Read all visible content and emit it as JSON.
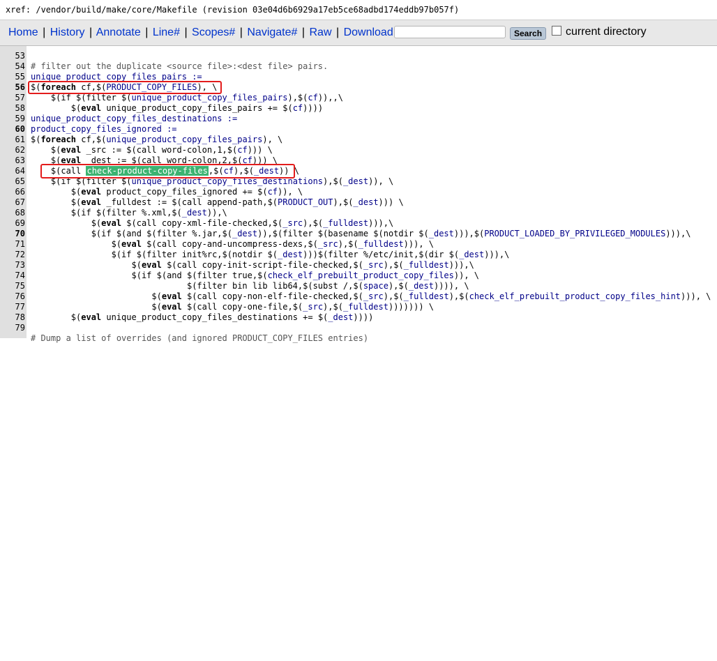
{
  "xref": {
    "prefix": "xref: ",
    "path": "/vendor/build/make/core/Makefile",
    "revision": " (revision 03e04d6b6929a17eb5ce68adbd174eddb97b057f)"
  },
  "nav": {
    "home": "Home",
    "history": "History",
    "annotate": "Annotate",
    "line": "Line#",
    "scopes": "Scopes#",
    "navigate": "Navigate#",
    "raw": "Raw",
    "download": "Download",
    "sep": "|",
    "search_button": "Search",
    "current_directory": "current directory"
  },
  "code": {
    "partial_top": "                                                          ",
    "lines": {
      "l53": {
        "n": "53"
      },
      "l54": {
        "n": "54",
        "t": "# filter out the duplicate <source file>:<dest file> pairs."
      },
      "l55": {
        "n": "55",
        "t": "unique_product_copy_files_pairs :="
      },
      "l56": {
        "n": "56",
        "a": "$(",
        "k": "foreach",
        "b": " cf,$(",
        "v": "PRODUCT_COPY_FILES",
        "c": "), \\"
      },
      "l57": {
        "n": "57",
        "a": "    $(if $(filter $(",
        "v": "unique_product_copy_files_pairs",
        "b": "),$(",
        "v2": "cf",
        "c": ")),,\\"
      },
      "l58": {
        "n": "58",
        "a": "        $(",
        "k": "eval",
        "b": " unique_product_copy_files_pairs += $(",
        "v": "cf",
        "c": "))))"
      },
      "l59": {
        "n": "59",
        "t": "unique_product_copy_files_destinations :="
      },
      "l60": {
        "n": "60",
        "t": "product_copy_files_ignored :="
      },
      "l61": {
        "n": "61",
        "a": "$(",
        "k": "foreach",
        "b": " cf,$(",
        "v": "unique_product_copy_files_pairs",
        "c": "), \\"
      },
      "l62": {
        "n": "62",
        "a": "    $(",
        "k": "eval",
        "b": " _src := $(call word-colon,1,$(",
        "v": "cf",
        "c": "))) \\"
      },
      "l63": {
        "n": "63",
        "a": "    $(",
        "k": "eval",
        "b": " _dest := $(call word-colon,2,$(",
        "v": "cf",
        "c": "))) \\"
      },
      "l64": {
        "n": "64",
        "a": "    $(call ",
        "h": "check-product-copy-files",
        "b": ",$(",
        "v": "cf",
        "c": "),$(",
        "v2": "_dest",
        "d": ")) \\"
      },
      "l65": {
        "n": "65",
        "a": "    $(if $(filter $(",
        "v": "unique_product_copy_files_destinations",
        "b": "),$(",
        "v2": "_dest",
        "c": ")), \\"
      },
      "l66": {
        "n": "66",
        "a": "        $(",
        "k": "eval",
        "b": " product_copy_files_ignored += $(",
        "v": "cf",
        "c": ")), \\"
      },
      "l67": {
        "n": "67",
        "a": "        $(",
        "k": "eval",
        "b": " _fulldest := $(call append-path,$(",
        "v": "PRODUCT_OUT",
        "c": "),$(",
        "v2": "_dest",
        "d": "))) \\"
      },
      "l68": {
        "n": "68",
        "a": "        $(if $(filter %.xml,$(",
        "v": "_dest",
        "b": ")),\\"
      },
      "l69": {
        "n": "69",
        "a": "            $(",
        "k": "eval",
        "b": " $(call copy-xml-file-checked,$(",
        "v": "_src",
        "c": "),$(",
        "v2": "_fulldest",
        "d": "))),\\"
      },
      "l70": {
        "n": "70",
        "a": "            $(if $(and $(filter %.jar,$(",
        "v": "_dest",
        "b": ")),$(filter $(basename $(notdir $(",
        "v2": "_dest",
        "c": "))),$(",
        "v3": "PRODUCT_LOADED_BY_PRIVILEGED_MODULES",
        "d": "))),\\"
      },
      "l71": {
        "n": "71",
        "a": "                $(",
        "k": "eval",
        "b": " $(call copy-and-uncompress-dexs,$(",
        "v": "_src",
        "c": "),$(",
        "v2": "_fulldest",
        "d": "))), \\"
      },
      "l72": {
        "n": "72",
        "a": "                $(if $(filter init%rc,$(notdir $(",
        "v": "_dest",
        "b": ")))$(filter %/etc/init,$(dir $(",
        "v2": "_dest",
        "c": "))),\\"
      },
      "l73": {
        "n": "73",
        "a": "                    $(",
        "k": "eval",
        "b": " $(call copy-init-script-file-checked,$(",
        "v": "_src",
        "c": "),$(",
        "v2": "_fulldest",
        "d": "))),\\"
      },
      "l74": {
        "n": "74",
        "a": "                    $(if $(and $(filter true,$(",
        "v": "check_elf_prebuilt_product_copy_files",
        "b": ")), \\"
      },
      "l75": {
        "n": "75",
        "a": "                               $(filter bin lib lib64,$(subst /,$(",
        "v": "space",
        "b": "),$(",
        "v2": "_dest",
        "c": ")))), \\"
      },
      "l76": {
        "n": "76",
        "a": "                        $(",
        "k": "eval",
        "b": " $(call copy-non-elf-file-checked,$(",
        "v": "_src",
        "c": "),$(",
        "v2": "_fulldest",
        "d": "),$(",
        "v3": "check_elf_prebuilt_product_copy_files_hint",
        "e": "))), \\"
      },
      "l77": {
        "n": "77",
        "a": "                        $(",
        "k": "eval",
        "b": " $(call copy-one-file,$(",
        "v": "_src",
        "c": "),$(",
        "v2": "_fulldest",
        "d": "))))))) \\"
      },
      "l78": {
        "n": "78",
        "a": "        $(",
        "k": "eval",
        "b": " unique_product_copy_files_destinations += $(",
        "v": "_dest",
        "c": "))))"
      },
      "l79": {
        "n": "79"
      },
      "l80": {
        "t": "# Dump a list of overrides (and ignored PRODUCT_COPY_FILES entries)"
      }
    }
  },
  "colors": {
    "link": "#0033cc",
    "highlight": "#3cb371",
    "redbox": "#e31c1c",
    "gutter": "#e0e0e0"
  }
}
